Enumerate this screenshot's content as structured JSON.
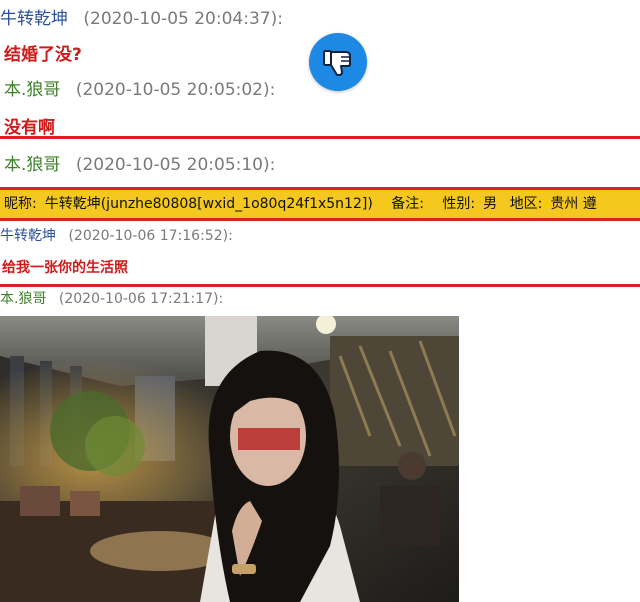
{
  "messages": [
    {
      "sender": "牛转乾坤",
      "time": "(2020-10-05 20:04:37):",
      "text": "结婚了没?"
    },
    {
      "sender": "本.狼哥",
      "time": "(2020-10-05 20:05:02):",
      "text": "没有啊"
    },
    {
      "sender": "本.狼哥",
      "time": "(2020-10-05 20:05:10):",
      "text": ""
    }
  ],
  "profile_bar": {
    "nickname_label": "昵称:",
    "nickname_value": "牛转乾坤(junzhe80808[wxid_1o80q24f1x5n12])",
    "note_label": "备注:",
    "gender_label": "性别:",
    "gender_value": "男",
    "region_label": "地区:",
    "region_value": "贵州 遵"
  },
  "messages2": [
    {
      "sender": "牛转乾坤",
      "time": "(2020-10-06 17:16:52):",
      "text": "给我一张你的生活照"
    },
    {
      "sender": "本.狼哥",
      "time": "(2020-10-06 17:21:17):",
      "text": ""
    }
  ],
  "icons": {
    "thumb": "thumbs-down-icon"
  },
  "colors": {
    "accent_red": "#d72323",
    "highlight_yellow": "#f4c81e",
    "button_blue": "#1e88e5"
  }
}
